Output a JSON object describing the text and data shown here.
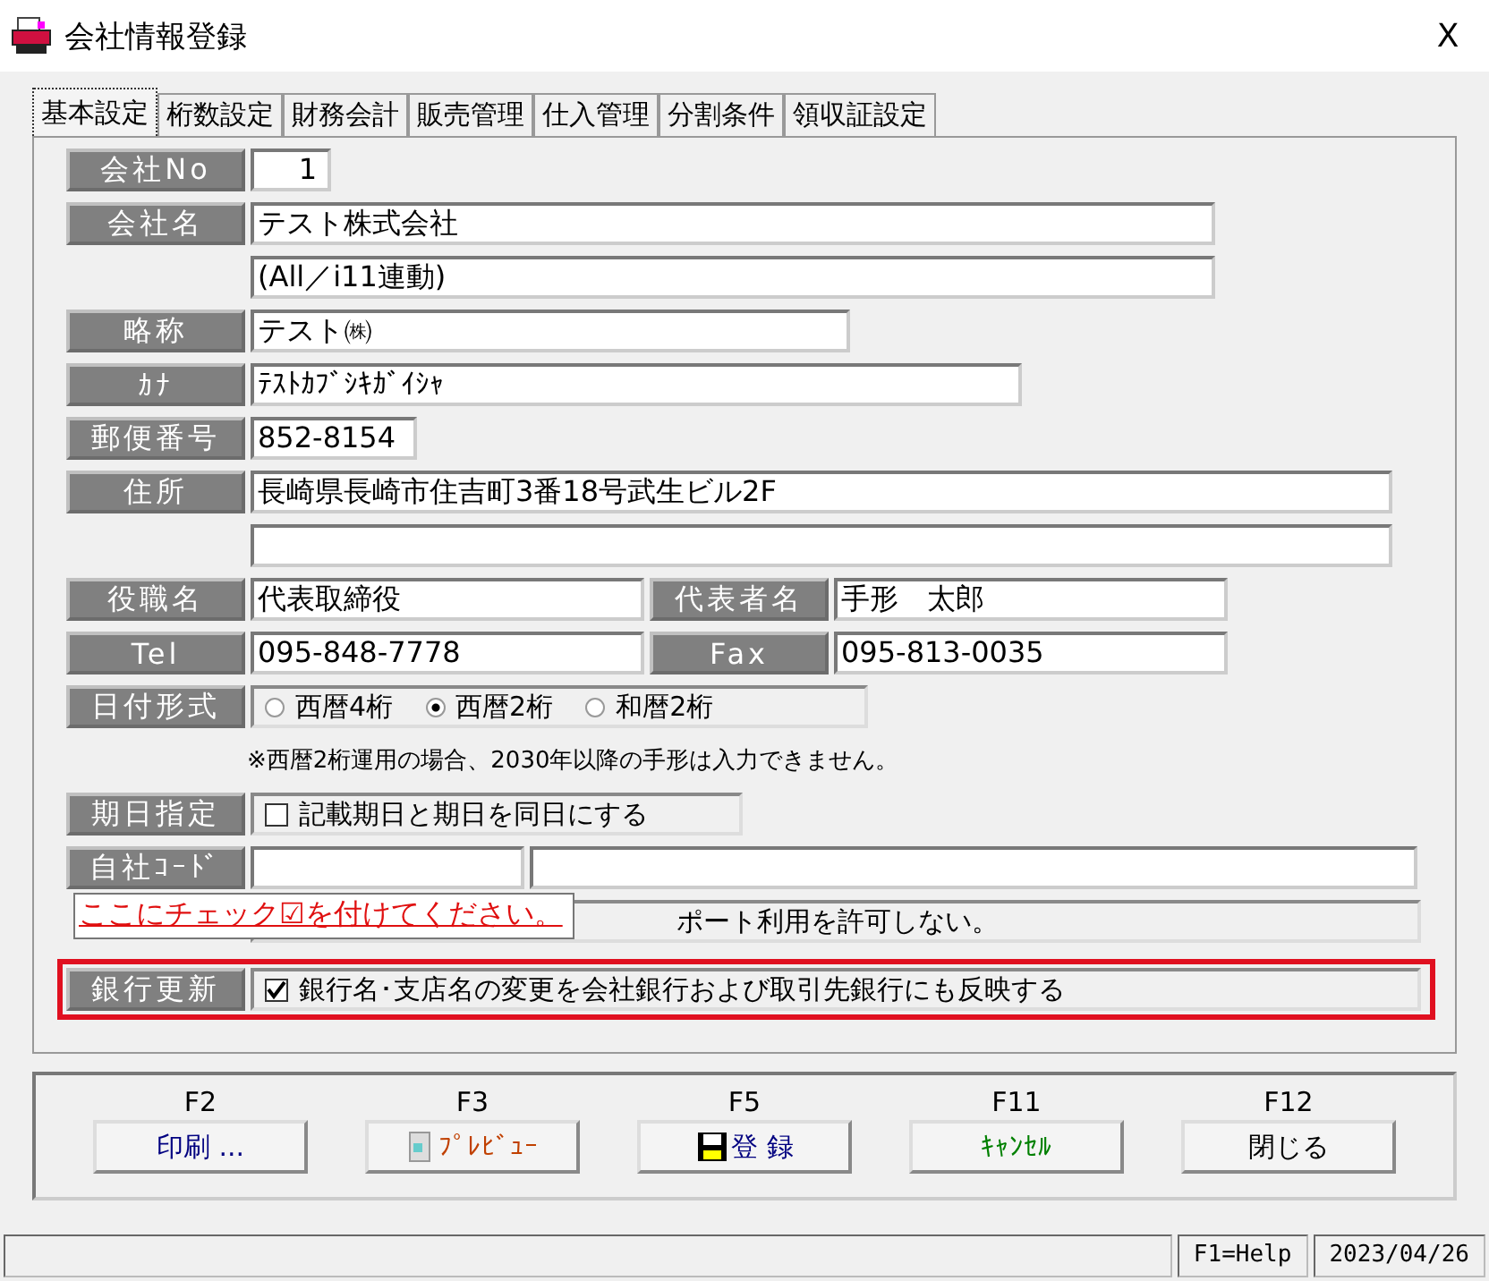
{
  "window": {
    "title": "会社情報登録",
    "close": "X"
  },
  "tabs": [
    {
      "label": "基本設定",
      "selected": true
    },
    {
      "label": "桁数設定",
      "selected": false
    },
    {
      "label": "財務会計",
      "selected": false
    },
    {
      "label": "販売管理",
      "selected": false
    },
    {
      "label": "仕入管理",
      "selected": false
    },
    {
      "label": "分割条件",
      "selected": false
    },
    {
      "label": "領収証設定",
      "selected": false
    }
  ],
  "rows": [
    {
      "label": "会社No",
      "cells": [
        {
          "kind": "input",
          "value": "1"
        }
      ]
    },
    {
      "label": "会社名",
      "cells": [
        {
          "kind": "input",
          "value": "テスト株式会社"
        }
      ]
    },
    {
      "cells": [
        {
          "kind": "input",
          "value": "(All／i11連動)"
        }
      ]
    },
    {
      "label": "略称",
      "cells": [
        {
          "kind": "input",
          "value": "テスト㈱"
        }
      ]
    },
    {
      "label": "ｶﾅ",
      "cells": [
        {
          "kind": "input",
          "value": "ﾃｽﾄｶﾌﾞｼｷｶﾞｲｼｬ"
        }
      ]
    },
    {
      "label": "郵便番号",
      "cells": [
        {
          "kind": "input",
          "value": "852-8154"
        }
      ]
    },
    {
      "label": "住所",
      "cells": [
        {
          "kind": "input",
          "value": "長崎県長崎市住吉町3番18号武生ビル2F"
        }
      ]
    },
    {
      "cells": [
        {
          "kind": "input"
        }
      ]
    },
    {
      "label": "役職名",
      "cells": [
        {
          "kind": "input",
          "value": "代表取締役"
        },
        {
          "kind": "label",
          "value": "代表者名"
        },
        {
          "kind": "input",
          "value": "手形　太郎"
        }
      ]
    },
    {
      "label": "Tel",
      "cells": [
        {
          "kind": "input",
          "value": "095-848-7778"
        },
        {
          "kind": "label",
          "value": "Fax"
        },
        {
          "kind": "input",
          "value": "095-813-0035"
        }
      ]
    },
    {
      "label": "日付形式",
      "cells": [
        {
          "kind": "radios",
          "options": [
            {
              "label": "西暦4桁",
              "selected": false
            },
            {
              "label": "西暦2桁",
              "selected": true
            },
            {
              "label": "和暦2桁",
              "selected": false
            }
          ]
        }
      ]
    },
    {
      "cells": [
        {
          "kind": "note",
          "value": "※西暦2桁運用の場合、2030年以降の手形は入力できません。"
        }
      ]
    },
    {
      "label": "期日指定",
      "cells": [
        {
          "kind": "checkbox",
          "value": "記載期日と期日を同日にする",
          "checked": false
        }
      ]
    },
    {
      "label": "自社ｺｰﾄﾞ",
      "cells": [
        {
          "kind": "input"
        },
        {
          "kind": "input"
        }
      ]
    },
    {
      "cells": [
        {
          "kind": "covered",
          "value": "ポート利用を許可しない。"
        }
      ]
    },
    {
      "label": "銀行更新",
      "highlighted": true,
      "cells": [
        {
          "kind": "checkbox",
          "value": "銀行名･支店名の変更を会社銀行および取引先銀行にも反映する",
          "checked": true
        }
      ]
    }
  ],
  "tooltip": "ここにチェック☑を付けてください。",
  "function_keys": [
    {
      "key": "F2",
      "label": "印刷 ...",
      "kind": "plain",
      "color": "#000080"
    },
    {
      "key": "F3",
      "label": "ﾌﾟﾚﾋﾞｭｰ",
      "kind": "preview",
      "color": "#c04000"
    },
    {
      "key": "F5",
      "label": "登 録",
      "kind": "save",
      "color": "#000080"
    },
    {
      "key": "F11",
      "label": "ｷｬﾝｾﾙ",
      "kind": "plain",
      "color": "#008000"
    },
    {
      "key": "F12",
      "label": "閉じる",
      "kind": "plain",
      "color": "#000000"
    }
  ],
  "status_bar": {
    "help": "F1=Help",
    "date": "2023/04/26"
  }
}
